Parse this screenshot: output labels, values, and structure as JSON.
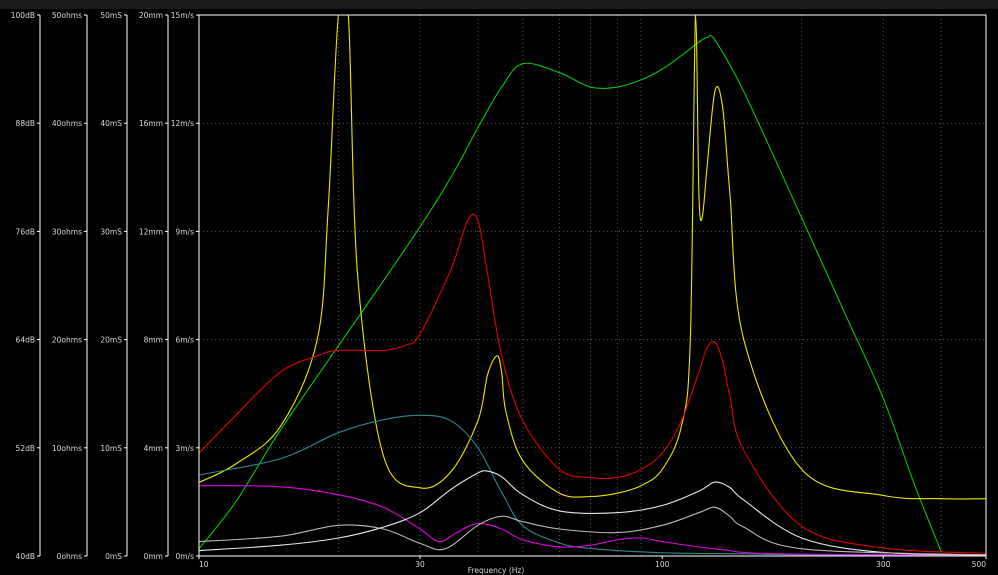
{
  "chart_data": {
    "type": "line",
    "title": "",
    "xlabel": "Frequency (Hz)",
    "x_scale": "log",
    "xlim": [
      10,
      500
    ],
    "x_ticks": [
      {
        "value": 10,
        "label": "10"
      },
      {
        "value": 30,
        "label": "30"
      },
      {
        "value": 100,
        "label": "100"
      },
      {
        "value": 300,
        "label": "300"
      },
      {
        "value": 500,
        "label": "500"
      }
    ],
    "x_minor_gridlines": [
      20,
      30,
      40,
      50,
      60,
      70,
      80,
      90,
      200,
      300,
      400
    ],
    "y_axes": [
      {
        "name": "dB",
        "range": [
          40,
          100
        ],
        "ticks": [
          "40dB",
          "52dB",
          "64dB",
          "76dB",
          "88dB",
          "100dB"
        ]
      },
      {
        "name": "ohms",
        "range": [
          0,
          50
        ],
        "ticks": [
          "0ohms",
          "10ohms",
          "20ohms",
          "30ohms",
          "40ohms",
          "50ohms"
        ]
      },
      {
        "name": "mS",
        "range": [
          0,
          50
        ],
        "ticks": [
          "0mS",
          "10mS",
          "20mS",
          "30mS",
          "40mS",
          "50mS"
        ]
      },
      {
        "name": "mm",
        "range": [
          0,
          20
        ],
        "ticks": [
          "0mm",
          "4mm",
          "8mm",
          "12mm",
          "16mm",
          "20mm"
        ]
      },
      {
        "name": "m/s",
        "range": [
          0,
          15
        ],
        "ticks": [
          "0m/s",
          "3m/s",
          "6m/s",
          "9m/s",
          "12m/s",
          "15m/s"
        ]
      }
    ],
    "grid": true,
    "series": [
      {
        "color": "#00c800",
        "axis": "dB",
        "x": [
          10,
          12,
          15,
          20,
          25,
          30,
          35,
          40,
          45,
          50,
          60,
          70,
          80,
          90,
          100,
          110,
          120,
          125,
          130,
          150,
          200,
          250,
          300,
          350,
          400
        ],
        "y": [
          40.8,
          46,
          54,
          63.3,
          70.5,
          76.5,
          82,
          87.5,
          92,
          94.6,
          93.6,
          92,
          92,
          92.8,
          94,
          95.5,
          97,
          97.5,
          97.2,
          91.5,
          77.5,
          66.5,
          57.5,
          48,
          40.5
        ]
      },
      {
        "color": "#e8e800",
        "axis": "ohms",
        "x": [
          10,
          12,
          15,
          18,
          19,
          20,
          21,
          22,
          25,
          30,
          35,
          40,
          42,
          44,
          45,
          46,
          50,
          60,
          70,
          80,
          90,
          100,
          110,
          115,
          118,
          120,
          122,
          125,
          130,
          135,
          140,
          150,
          200,
          300,
          400,
          500
        ],
        "y": [
          6.8,
          8.5,
          12,
          20,
          32,
          52,
          52,
          26,
          9.3,
          6.3,
          7.8,
          12.5,
          16.8,
          18.5,
          17,
          13.3,
          8.8,
          5.8,
          5.5,
          5.8,
          6.5,
          8,
          12,
          20,
          52,
          33.5,
          31.3,
          36,
          43,
          41.5,
          33.5,
          20,
          8,
          5.6,
          5.3,
          5.3
        ]
      },
      {
        "color": "#e00000",
        "axis": "mm",
        "x": [
          10,
          12,
          15,
          18,
          20,
          25,
          28,
          30,
          35,
          38,
          40,
          42,
          45,
          50,
          60,
          70,
          80,
          90,
          100,
          110,
          120,
          125,
          130,
          135,
          140,
          150,
          200,
          300,
          500
        ],
        "y": [
          3.8,
          5.2,
          6.8,
          7.4,
          7.6,
          7.6,
          7.8,
          8.2,
          10.6,
          12.4,
          12.4,
          10.4,
          7.4,
          5,
          3.2,
          2.9,
          2.9,
          3.2,
          3.8,
          5,
          6.8,
          7.7,
          7.9,
          7.2,
          5.9,
          3.9,
          1.1,
          0.3,
          0.1
        ]
      },
      {
        "color": "#2a8a8a",
        "axis": "mS",
        "x": [
          10,
          15,
          20,
          25,
          30,
          35,
          40,
          45,
          50,
          60,
          70,
          100,
          150,
          200,
          500
        ],
        "y": [
          7.5,
          9,
          11.4,
          12.6,
          13,
          12.5,
          10,
          5.9,
          2.8,
          1.2,
          0.7,
          0.3,
          0.2,
          0.1,
          0.05
        ]
      },
      {
        "color": "#e000e0",
        "axis": "m/s",
        "x": [
          10,
          15,
          20,
          25,
          30,
          33,
          36,
          40,
          45,
          50,
          60,
          70,
          80,
          90,
          100,
          120,
          130,
          140,
          150,
          200,
          500
        ],
        "y": [
          1.95,
          1.92,
          1.7,
          1.35,
          0.75,
          0.4,
          0.65,
          0.9,
          0.75,
          0.45,
          0.25,
          0.3,
          0.45,
          0.5,
          0.4,
          0.25,
          0.2,
          0.15,
          0.1,
          0.05,
          0.03
        ]
      },
      {
        "color": "#e8e8e8",
        "axis": "m/s",
        "x": [
          10,
          15,
          20,
          25,
          30,
          35,
          40,
          42,
          45,
          50,
          60,
          80,
          100,
          120,
          130,
          140,
          150,
          200,
          300,
          500
        ],
        "y": [
          0.15,
          0.3,
          0.5,
          0.8,
          1.2,
          1.85,
          2.3,
          2.35,
          2.2,
          1.7,
          1.25,
          1.2,
          1.4,
          1.8,
          2.05,
          1.9,
          1.55,
          0.5,
          0.1,
          0.03
        ]
      },
      {
        "color": "#b8b8b8",
        "axis": "m/s",
        "x": [
          10,
          15,
          20,
          25,
          30,
          34,
          40,
          45,
          50,
          60,
          80,
          100,
          120,
          130,
          140,
          150,
          200,
          500
        ],
        "y": [
          0.4,
          0.55,
          0.85,
          0.75,
          0.35,
          0.2,
          0.85,
          1.1,
          0.95,
          0.75,
          0.65,
          0.85,
          1.2,
          1.35,
          1.1,
          0.8,
          0.2,
          0.03
        ]
      }
    ]
  }
}
